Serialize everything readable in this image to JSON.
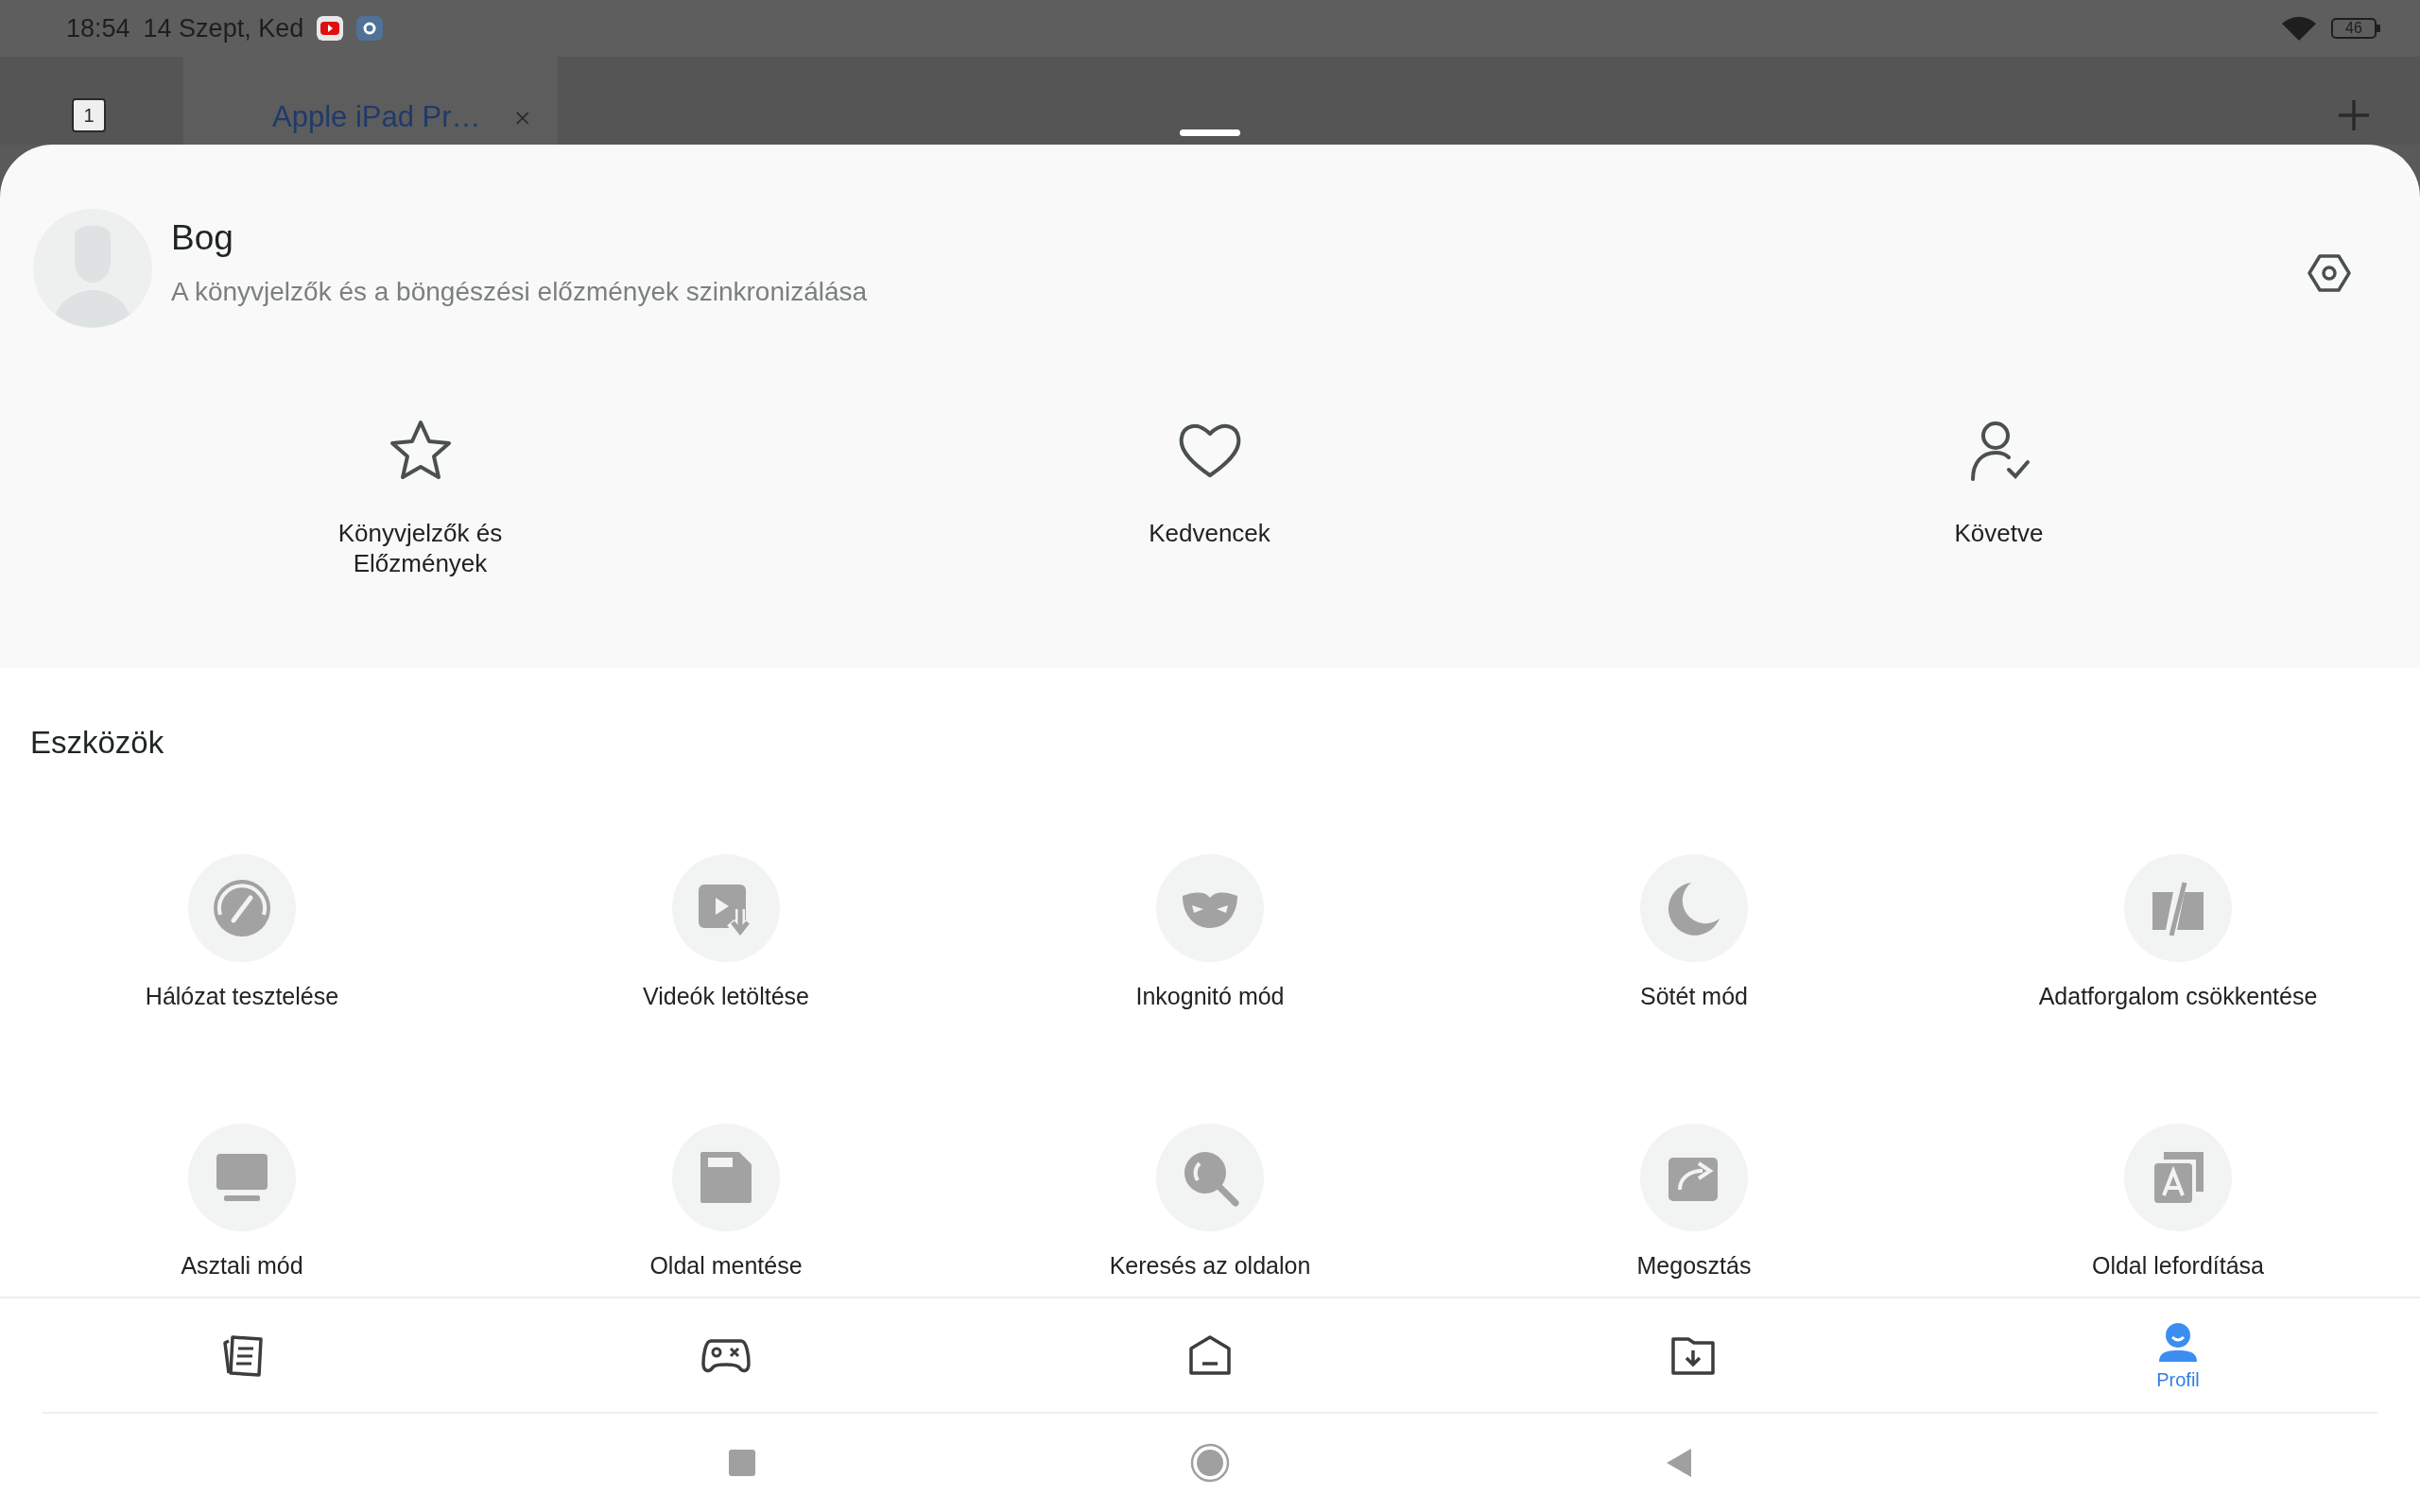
{
  "status_bar": {
    "time": "18:54",
    "date": "14 Szept, Ked",
    "battery": "46"
  },
  "tab_bar": {
    "tab_count": "1",
    "tabs": [
      {
        "title": "Apple iPad Pr…",
        "selected": true
      }
    ]
  },
  "profile": {
    "name": "Bog",
    "subtitle": "A könyvjelzők és a böngészési előzmények szinkronizálása"
  },
  "shortcuts": [
    {
      "kind": "star",
      "label": "Könyvjelzők és Előzmények"
    },
    {
      "kind": "heart",
      "label": "Kedvencek"
    },
    {
      "kind": "following",
      "label": "Követve"
    }
  ],
  "tools": {
    "title": "Eszközök",
    "items": [
      {
        "kind": "speed",
        "label": "Hálózat tesztelése"
      },
      {
        "kind": "video",
        "label": "Videók letöltése"
      },
      {
        "kind": "mask",
        "label": "Inkognitó mód"
      },
      {
        "kind": "moon",
        "label": "Sötét mód"
      },
      {
        "kind": "saver",
        "label": "Adatforgalom csökkentése"
      },
      {
        "kind": "desktop",
        "label": "Asztali mód"
      },
      {
        "kind": "save",
        "label": "Oldal mentése"
      },
      {
        "kind": "find",
        "label": "Keresés az oldalon"
      },
      {
        "kind": "share",
        "label": "Megosztás"
      },
      {
        "kind": "translate",
        "label": "Oldal lefordítása"
      }
    ]
  },
  "bottom_nav": [
    {
      "kind": "feed",
      "selected": false
    },
    {
      "kind": "games",
      "selected": false
    },
    {
      "kind": "home",
      "selected": false
    },
    {
      "kind": "downloads",
      "selected": false
    },
    {
      "kind": "profile",
      "label": "Profil",
      "selected": true
    }
  ]
}
